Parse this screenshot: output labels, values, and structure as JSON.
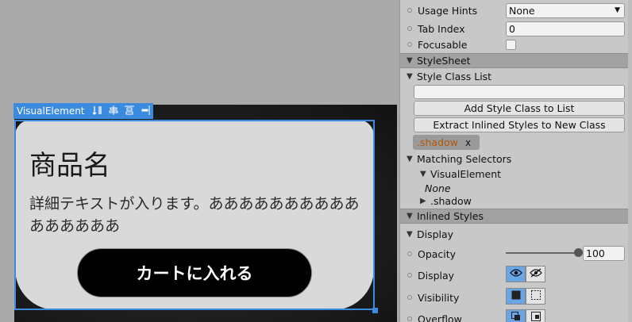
{
  "canvas": {
    "card": {
      "title": "商品名",
      "description": "詳細テキストが入ります。ああああああああああああああああ",
      "button_label": "カートに入れる"
    },
    "selection": {
      "element_name": "VisualElement"
    }
  },
  "inspector": {
    "usage_hints": {
      "label": "Usage Hints",
      "value": "None"
    },
    "tab_index": {
      "label": "Tab Index",
      "value": "0"
    },
    "focusable": {
      "label": "Focusable",
      "checked": false
    },
    "stylesheet_header": "StyleSheet",
    "style_class_list": {
      "label": "Style Class List",
      "input_value": "",
      "add_button": "Add Style Class to List",
      "extract_button": "Extract Inlined Styles to New Class",
      "classes": [
        {
          "name": ".shadow",
          "remove": "x"
        }
      ]
    },
    "matching_selectors": {
      "label": "Matching Selectors",
      "groups": [
        {
          "name": "VisualElement",
          "items": [
            "None"
          ]
        },
        {
          "name": ".shadow"
        }
      ]
    },
    "inlined_styles_header": "Inlined Styles",
    "display_section": {
      "label": "Display",
      "opacity": {
        "label": "Opacity",
        "value": "100",
        "fraction": 1.0
      },
      "display": {
        "label": "Display"
      },
      "visibility": {
        "label": "Visibility"
      },
      "overflow": {
        "label": "Overflow"
      }
    }
  },
  "colors": {
    "selection_blue": "#3a8ae0",
    "class_tag_text": "#b4560a",
    "toggle_active": "#6aa6e6"
  }
}
